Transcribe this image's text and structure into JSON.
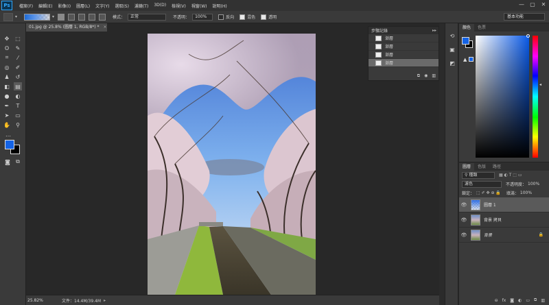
{
  "app": {
    "logo": "Ps"
  },
  "menus": [
    "檔案(F)",
    "編輯(E)",
    "影像(I)",
    "圖層(L)",
    "文字(Y)",
    "選取(S)",
    "濾鏡(T)",
    "3D(D)",
    "檢視(V)",
    "視窗(W)",
    "說明(H)"
  ],
  "window_controls": {
    "minimize": "—",
    "maximize": "▢",
    "close": "✕"
  },
  "options": {
    "mode_label": "模式：",
    "mode_value": "正常",
    "opacity_label": "不透明：",
    "opacity_value": "100%",
    "reverse_label": "反向",
    "dither_label": "混色",
    "transparency_label": "透明",
    "reverse_checked": false,
    "dither_checked": true,
    "transparency_checked": true,
    "workspace": "基本功能"
  },
  "document": {
    "tab_title": "01.jpg @ 25.8% (圖層 1, RGB/8*) *",
    "tab_close": "×",
    "zoom": "25.82%",
    "doc_info": "文件：14.4M/39.4M"
  },
  "history": {
    "title": "步驟記錄",
    "collapse": "▸▸",
    "menu": "≡",
    "items": [
      {
        "label": "漸層",
        "active": false
      },
      {
        "label": "漸層",
        "active": false
      },
      {
        "label": "漸層",
        "active": false
      },
      {
        "label": "漸層",
        "active": true
      }
    ]
  },
  "color_panel": {
    "tabs": [
      "顏色",
      "色票"
    ],
    "active_tab": 0,
    "fg": "#1463e6",
    "bg": "#000000",
    "gamut_warning": "▲"
  },
  "layers_panel": {
    "tabs": [
      "圖層",
      "色版",
      "路徑"
    ],
    "active_tab": 0,
    "filter_label": "種類",
    "blend_mode": "濾色",
    "opacity_label": "不透明度：",
    "opacity_value": "100%",
    "lock_label": "鎖定：",
    "fill_label": "填滿：",
    "fill_value": "100%",
    "layers": [
      {
        "name": "圖層 1",
        "visible": true,
        "active": true,
        "italic": false,
        "locked": false,
        "thumb": "transparent"
      },
      {
        "name": "背景 拷貝",
        "visible": true,
        "active": false,
        "italic": false,
        "locked": false,
        "thumb": "photo"
      },
      {
        "name": "背景",
        "visible": true,
        "active": false,
        "italic": true,
        "locked": true,
        "thumb": "photo"
      }
    ]
  },
  "tools": [
    "move-tool",
    "marquee-tool",
    "lasso-tool",
    "quick-select-tool",
    "crop-tool",
    "eyedropper-tool",
    "healing-brush-tool",
    "brush-tool",
    "clone-stamp-tool",
    "history-brush-tool",
    "eraser-tool",
    "gradient-tool",
    "blur-tool",
    "dodge-tool",
    "pen-tool",
    "type-tool",
    "path-select-tool",
    "shape-tool",
    "hand-tool",
    "zoom-tool"
  ]
}
